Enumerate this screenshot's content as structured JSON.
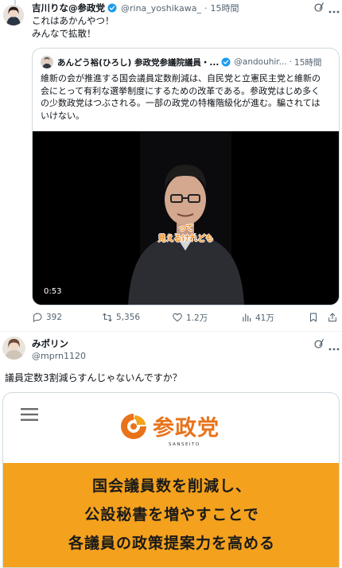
{
  "post1": {
    "author_name": "吉川りな@参政党",
    "handle": "@rina_yoshikawa_",
    "dot": "·",
    "time": "15時間",
    "text_line1": "これはあかんやつ！",
    "text_line2": "みんなで拡散！"
  },
  "quote": {
    "author_name": "あんどう裕(ひろし) 参政党参議院議員・...",
    "handle": "@andouhir...",
    "dot": "·",
    "time": "15時間",
    "text_lines": [
      "維新の会が推進する国会議員定数削減は、自民党と立憲民主党と維新の",
      "会にとって有利な選挙制度にするための改革である。参政党はじめ多く",
      "の少数政党はつぶされる。一部の政党の特権階級化が進む。騙されては",
      "いけない。"
    ],
    "video": {
      "caption_line1": "って",
      "caption_line2": "見えるけれども",
      "duration": "0:53"
    }
  },
  "actions": {
    "replies": "392",
    "reposts": "5,356",
    "likes": "1.2万",
    "views": "41万"
  },
  "post2": {
    "author_name": "みポリン",
    "handle": "@mprn1120",
    "text": "議員定数3割減らすんじゃないんですか？",
    "banner": {
      "logo_text": "参政党",
      "logo_sub": "SANSEITO",
      "lines": [
        "国会議員数を削減し、",
        "公設秘書を増やすことで",
        "各議員の政策提案力を高める"
      ]
    }
  },
  "colors": {
    "verified": "#1d9bf0",
    "muted": "#536471",
    "banner_orange": "#f4a11d",
    "logo_orange": "#e8731a"
  }
}
